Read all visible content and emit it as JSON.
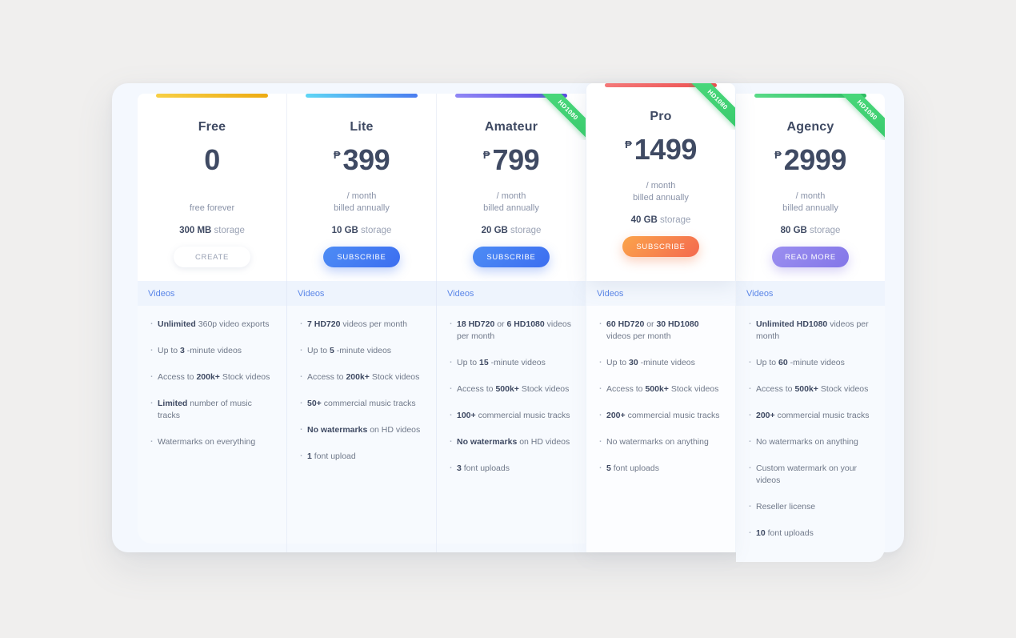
{
  "panel": {
    "section_label": "Videos",
    "ribbon_label": "HD1080"
  },
  "plans": [
    {
      "name": "Free",
      "currency": "",
      "price": "0",
      "billing_line1": "free forever",
      "billing_line2": "",
      "storage_value": "300 MB",
      "storage_label": " storage",
      "cta_label": "CREATE",
      "cta_style": "ghost",
      "accent": "#f0b41d",
      "ribbon": false,
      "featured": false,
      "features": [
        {
          "bold": "Unlimited",
          "rest": " 360p video exports",
          "lead": ""
        },
        {
          "bold": "3",
          "rest": " -minute videos",
          "lead": "Up to "
        },
        {
          "bold": "200k+",
          "rest": " Stock videos",
          "lead": "Access to "
        },
        {
          "bold": "Limited",
          "rest": " number of music tracks",
          "lead": ""
        },
        {
          "bold": "",
          "rest": "Watermarks on everything",
          "lead": ""
        }
      ]
    },
    {
      "name": "Lite",
      "currency": "₱",
      "price": "399",
      "billing_line1": "/ month",
      "billing_line2": "billed annually",
      "storage_value": "10 GB",
      "storage_label": " storage",
      "cta_label": "SUBSCRIBE",
      "cta_style": "blue",
      "accent": "#56c8f2",
      "ribbon": false,
      "featured": false,
      "features": [
        {
          "bold": "7 HD720",
          "rest": " videos per month",
          "lead": ""
        },
        {
          "bold": "5",
          "rest": " -minute videos",
          "lead": "Up to "
        },
        {
          "bold": "200k+",
          "rest": " Stock videos",
          "lead": "Access to "
        },
        {
          "bold": "50+",
          "rest": " commercial music tracks",
          "lead": ""
        },
        {
          "bold": "No watermarks",
          "rest": " on HD videos",
          "lead": ""
        },
        {
          "bold": "1",
          "rest": " font upload",
          "lead": ""
        }
      ]
    },
    {
      "name": "Amateur",
      "currency": "₱",
      "price": "799",
      "billing_line1": "/ month",
      "billing_line2": "billed annually",
      "storage_value": "20 GB",
      "storage_label": " storage",
      "cta_label": "SUBSCRIBE",
      "cta_style": "blue",
      "accent": "#7b6df0",
      "ribbon": true,
      "featured": false,
      "features": [
        {
          "bold": "18 HD720",
          "rest": " videos per month",
          "lead": "",
          "mid": " or ",
          "bold2": "6 HD1080"
        },
        {
          "bold": "15",
          "rest": " -minute videos",
          "lead": "Up to "
        },
        {
          "bold": "500k+",
          "rest": " Stock videos",
          "lead": "Access to "
        },
        {
          "bold": "100+",
          "rest": " commercial music tracks",
          "lead": ""
        },
        {
          "bold": "No watermarks",
          "rest": " on HD videos",
          "lead": ""
        },
        {
          "bold": "3",
          "rest": " font uploads",
          "lead": ""
        }
      ]
    },
    {
      "name": "Pro",
      "currency": "₱",
      "price": "1499",
      "billing_line1": "/ month",
      "billing_line2": "billed annually",
      "storage_value": "40 GB",
      "storage_label": " storage",
      "cta_label": "SUBSCRIBE",
      "cta_style": "orange",
      "accent": "#f05f5f",
      "ribbon": true,
      "featured": true,
      "features": [
        {
          "bold": "60 HD720",
          "rest": " videos per month",
          "lead": "",
          "mid": " or ",
          "bold2": "30 HD1080"
        },
        {
          "bold": "30",
          "rest": " -minute videos",
          "lead": "Up to "
        },
        {
          "bold": "500k+",
          "rest": " Stock videos",
          "lead": "Access to "
        },
        {
          "bold": "200+",
          "rest": " commercial music tracks",
          "lead": ""
        },
        {
          "bold": "",
          "rest": "No watermarks on anything",
          "lead": ""
        },
        {
          "bold": "5",
          "rest": " font uploads",
          "lead": ""
        }
      ]
    },
    {
      "name": "Agency",
      "currency": "₱",
      "price": "2999",
      "billing_line1": "/ month",
      "billing_line2": "billed annually",
      "storage_value": "80 GB",
      "storage_label": " storage",
      "cta_label": "READ MORE",
      "cta_style": "purple",
      "accent": "#3ecb72",
      "ribbon": true,
      "featured": false,
      "features": [
        {
          "bold": "Unlimited HD1080",
          "rest": " videos per month",
          "lead": ""
        },
        {
          "bold": "60",
          "rest": " -minute videos",
          "lead": "Up to "
        },
        {
          "bold": "500k+",
          "rest": " Stock videos",
          "lead": "Access to "
        },
        {
          "bold": "200+",
          "rest": " commercial music tracks",
          "lead": ""
        },
        {
          "bold": "",
          "rest": "No watermarks on anything",
          "lead": ""
        },
        {
          "bold": "",
          "rest": "Custom watermark on your videos",
          "lead": ""
        },
        {
          "bold": "",
          "rest": "Reseller license",
          "lead": ""
        },
        {
          "bold": "10",
          "rest": " font uploads",
          "lead": ""
        }
      ]
    }
  ]
}
